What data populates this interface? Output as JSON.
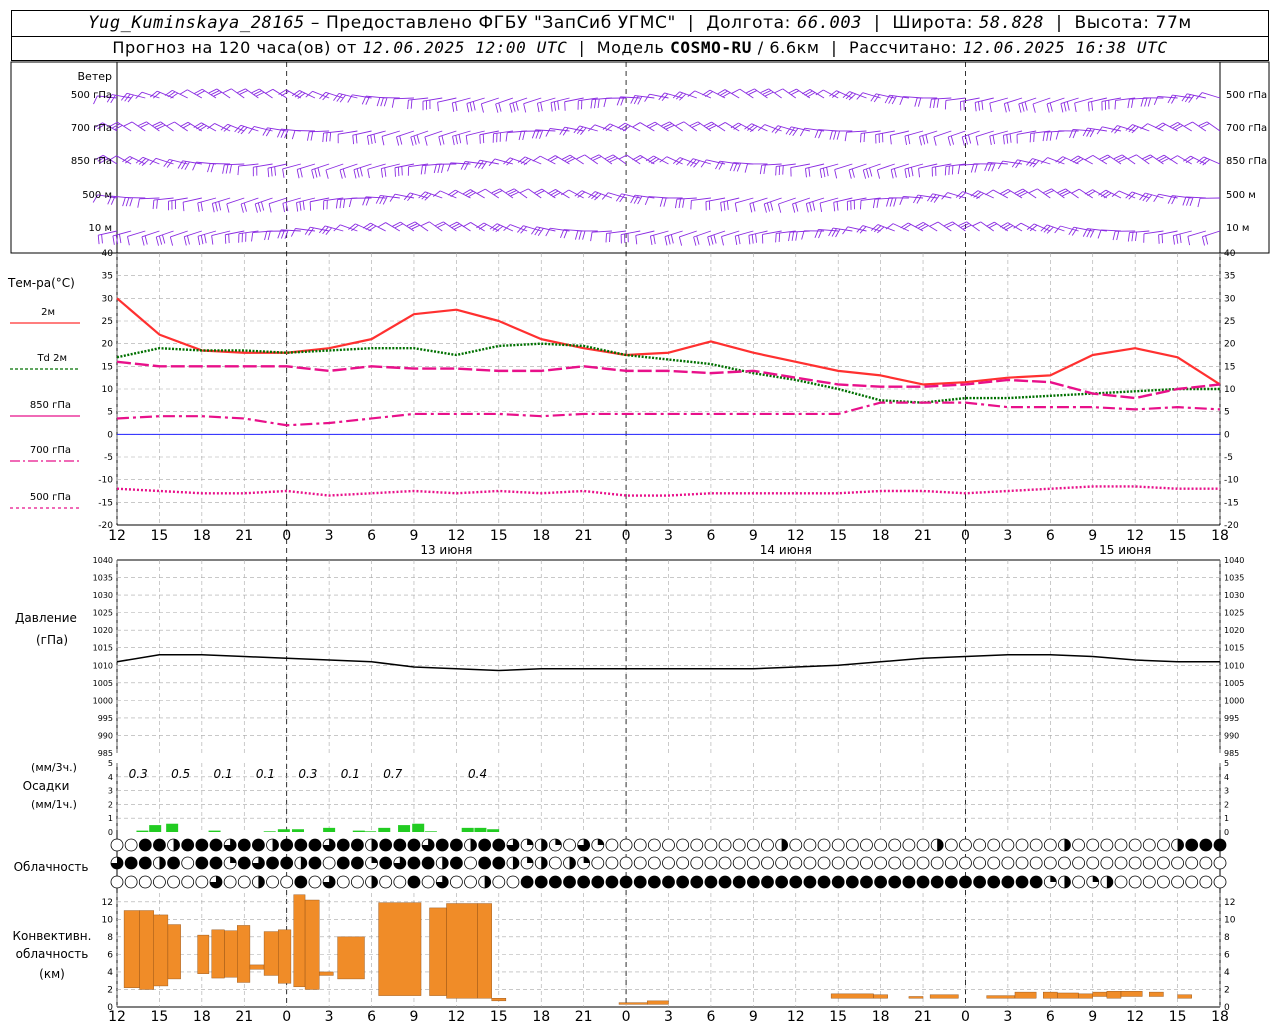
{
  "header": {
    "station": "Yug_Kuminskaya_28165",
    "provider": "– Предоставлено ФГБУ \"ЗапСиб УГМС\"",
    "lon_label": "Долгота:",
    "lon_value": "66.003",
    "lat_label": "Широта:",
    "lat_value": "58.828",
    "alt_label": "Высота:",
    "alt_value": "77м",
    "forecast_prefix": "Прогноз на 120 часа(ов) от",
    "forecast_start": "12.06.2025 12:00 UTC",
    "model_label": "Модель",
    "model_name": "COSMO-RU",
    "model_res": "/ 6.6км",
    "calc_label": "Рассчитано:",
    "calc_time": "12.06.2025 16:38 UTC"
  },
  "wind_panel": {
    "title": "Ветер",
    "levels": [
      "500 гПа",
      "700 гПа",
      "850 гПа",
      "500 м",
      "10 м"
    ]
  },
  "temp_panel": {
    "title": "Тем-ра(°С)",
    "legend": [
      {
        "label": "2м",
        "color": "#ff3030"
      },
      {
        "label": "Td 2м",
        "color": "#007000"
      },
      {
        "label": "850 гПа",
        "color": "#e8108a"
      },
      {
        "label": "700 гПа",
        "color": "#e8108a"
      },
      {
        "label": "500 гПа",
        "color": "#e8108a"
      }
    ]
  },
  "pressure_panel": {
    "title_1": "Давление",
    "title_2": "(гПа)"
  },
  "precip_panel": {
    "title_1": "(мм/3ч.)",
    "title_2": "Осадки",
    "title_3": "(мм/1ч.)"
  },
  "cloud_panel": {
    "title": "Облачность"
  },
  "conv_panel": {
    "title_1": "Конвективн.",
    "title_2": "облачность",
    "title_3": "(км)"
  },
  "time_axis": {
    "tick_labels": [
      "12",
      "15",
      "18",
      "21",
      "0",
      "3",
      "6",
      "9",
      "12",
      "15",
      "18",
      "21",
      "0",
      "3",
      "6",
      "9",
      "12",
      "15",
      "18",
      "21",
      "0",
      "3",
      "6",
      "9",
      "12",
      "15",
      "18"
    ],
    "dates": [
      "13 июня",
      "14 июня",
      "15 июня"
    ]
  },
  "colors": {
    "wind": "#8a2be2",
    "t2m": "#ff3030",
    "td2m": "#007000",
    "upper": "#e8108a",
    "zero_line": "#2020ff",
    "pressure": "#000000",
    "precip": "#22cc22",
    "convective": "#f08c28",
    "grid": "#a8a8a8"
  },
  "chart_data": [
    {
      "type": "line",
      "title": "Тем-ра(°С)",
      "x": [
        0,
        3,
        6,
        9,
        12,
        15,
        18,
        21,
        24,
        27,
        30,
        33,
        36,
        39,
        42,
        45,
        48,
        51,
        54,
        57,
        60,
        63,
        66,
        69,
        72,
        75,
        78
      ],
      "ylim": [
        -20,
        40
      ],
      "yticks": [
        -20,
        -15,
        -10,
        -5,
        0,
        5,
        10,
        15,
        20,
        25,
        30,
        35,
        40
      ],
      "series": [
        {
          "name": "2м",
          "style": "solid",
          "values": [
            30,
            22,
            18.5,
            18,
            18,
            19,
            21,
            26.5,
            27.5,
            25,
            21,
            19,
            17.5,
            18,
            20.5,
            18,
            16,
            14,
            13,
            11,
            11.5,
            12.5,
            13,
            17.5,
            19,
            17,
            11
          ]
        },
        {
          "name": "Td 2м",
          "style": "dotted",
          "values": [
            17,
            19,
            18.5,
            18.5,
            18,
            18.5,
            19,
            19,
            17.5,
            19.5,
            20,
            19.5,
            17.5,
            16.5,
            15.5,
            13.5,
            12,
            10,
            7.5,
            7,
            8,
            8,
            8.5,
            9,
            9.5,
            10,
            10
          ]
        },
        {
          "name": "850 гПа",
          "style": "longdash",
          "values": [
            16,
            15,
            15,
            15,
            15,
            14,
            15,
            14.5,
            14.5,
            14,
            14,
            15,
            14,
            14,
            13.5,
            14,
            12.5,
            11,
            10.5,
            10.5,
            11,
            12,
            11.5,
            9,
            8,
            10,
            11
          ]
        },
        {
          "name": "700 гПа",
          "style": "dashdot",
          "values": [
            3.5,
            4,
            4,
            3.5,
            2,
            2.5,
            3.5,
            4.5,
            4.5,
            4.5,
            4,
            4.5,
            4.5,
            4.5,
            4.5,
            4.5,
            4.5,
            4.5,
            7,
            7,
            7,
            6,
            6,
            6,
            5.5,
            6,
            5.5
          ]
        },
        {
          "name": "500 гПа",
          "style": "dotted",
          "values": [
            -12,
            -12.5,
            -13,
            -13,
            -12.5,
            -13.5,
            -13,
            -12.5,
            -13,
            -12.5,
            -13,
            -12.5,
            -13.5,
            -13.5,
            -13,
            -13,
            -13,
            -13,
            -12.5,
            -12.5,
            -13,
            -12.5,
            -12,
            -11.5,
            -11.5,
            -12,
            -12
          ]
        }
      ]
    },
    {
      "type": "line",
      "title": "Давление (гПа)",
      "x": [
        0,
        3,
        6,
        9,
        12,
        15,
        18,
        21,
        24,
        27,
        30,
        33,
        36,
        39,
        42,
        45,
        48,
        51,
        54,
        57,
        60,
        63,
        66,
        69,
        72,
        75,
        78
      ],
      "ylim": [
        985,
        1040
      ],
      "yticks": [
        985,
        990,
        995,
        1000,
        1005,
        1010,
        1015,
        1020,
        1025,
        1030,
        1035,
        1040
      ],
      "series": [
        {
          "name": "Давление",
          "values": [
            1011,
            1013,
            1013,
            1012.5,
            1012,
            1011.5,
            1011,
            1009.5,
            1009,
            1008.5,
            1009,
            1009,
            1009,
            1009,
            1009,
            1009,
            1009.5,
            1010,
            1011,
            1012,
            1012.5,
            1013,
            1013,
            1012.5,
            1011.5,
            1011,
            1011
          ]
        }
      ]
    },
    {
      "type": "bar",
      "title": "Осадки",
      "ylim": [
        0,
        5
      ],
      "yticks": [
        0,
        1,
        2,
        3,
        4,
        5
      ],
      "x": [
        1.8,
        2.7,
        3.9,
        6.9,
        10.8,
        11.8,
        12.8,
        15.0,
        17.1,
        17.9,
        18.9,
        20.3,
        21.3,
        22.2,
        24.8,
        25.7,
        26.6
      ],
      "values": [
        0.1,
        0.5,
        0.6,
        0.1,
        0.05,
        0.2,
        0.2,
        0.3,
        0.1,
        0.05,
        0.3,
        0.5,
        0.6,
        0.05,
        0.3,
        0.3,
        0.2
      ],
      "annotations": [
        {
          "x": 1.5,
          "text": "0.3"
        },
        {
          "x": 4.5,
          "text": "0.5"
        },
        {
          "x": 7.5,
          "text": "0.1"
        },
        {
          "x": 10.5,
          "text": "0.1"
        },
        {
          "x": 13.5,
          "text": "0.3"
        },
        {
          "x": 16.5,
          "text": "0.1"
        },
        {
          "x": 19.5,
          "text": "0.7"
        },
        {
          "x": 25.5,
          "text": "0.4"
        }
      ]
    },
    {
      "type": "bar",
      "title": "Конвективн. облачность (км)",
      "ylim": [
        0,
        13
      ],
      "yticks": [
        0,
        2,
        4,
        6,
        8,
        10,
        12
      ],
      "bars": [
        {
          "x0": 0.5,
          "x1": 1.6,
          "b": 2.2,
          "t": 11
        },
        {
          "x0": 1.6,
          "x1": 2.6,
          "b": 2,
          "t": 11
        },
        {
          "x0": 2.6,
          "x1": 3.6,
          "b": 2.4,
          "t": 10.5
        },
        {
          "x0": 3.6,
          "x1": 4.5,
          "b": 3.2,
          "t": 9.4
        },
        {
          "x0": 5.7,
          "x1": 6.5,
          "b": 3.8,
          "t": 8.2
        },
        {
          "x0": 6.7,
          "x1": 7.6,
          "b": 3.3,
          "t": 8.8
        },
        {
          "x0": 7.6,
          "x1": 8.5,
          "b": 3.4,
          "t": 8.7
        },
        {
          "x0": 8.5,
          "x1": 9.4,
          "b": 2.8,
          "t": 9.3
        },
        {
          "x0": 9.4,
          "x1": 10.4,
          "b": 4.3,
          "t": 4.8
        },
        {
          "x0": 10.4,
          "x1": 11.4,
          "b": 3.6,
          "t": 8.6
        },
        {
          "x0": 11.4,
          "x1": 12.3,
          "b": 2.7,
          "t": 8.8
        },
        {
          "x0": 12.5,
          "x1": 13.3,
          "b": 2.3,
          "t": 12.8
        },
        {
          "x0": 13.3,
          "x1": 14.3,
          "b": 2,
          "t": 12.2
        },
        {
          "x0": 14.3,
          "x1": 15.3,
          "b": 3.6,
          "t": 4
        },
        {
          "x0": 15.6,
          "x1": 17.5,
          "b": 3.2,
          "t": 8
        },
        {
          "x0": 18.5,
          "x1": 21.5,
          "b": 1.3,
          "t": 11.9
        },
        {
          "x0": 22.1,
          "x1": 23.3,
          "b": 1.3,
          "t": 11.3
        },
        {
          "x0": 23.3,
          "x1": 25.5,
          "b": 1,
          "t": 11.8
        },
        {
          "x0": 25.5,
          "x1": 26.5,
          "b": 1,
          "t": 11.8
        },
        {
          "x0": 26.5,
          "x1": 27.5,
          "b": 0.7,
          "t": 1
        },
        {
          "x0": 35.5,
          "x1": 37.5,
          "b": 0.3,
          "t": 0.5
        },
        {
          "x0": 37.5,
          "x1": 39,
          "b": 0.3,
          "t": 0.7
        },
        {
          "x0": 50.5,
          "x1": 53.5,
          "b": 1,
          "t": 1.5
        },
        {
          "x0": 53.5,
          "x1": 54.5,
          "b": 1,
          "t": 1.4
        },
        {
          "x0": 56,
          "x1": 57,
          "b": 1,
          "t": 1.2
        },
        {
          "x0": 57.5,
          "x1": 59.5,
          "b": 1,
          "t": 1.4
        },
        {
          "x0": 61.5,
          "x1": 63.5,
          "b": 1,
          "t": 1.3
        },
        {
          "x0": 63.5,
          "x1": 65,
          "b": 1,
          "t": 1.7
        },
        {
          "x0": 65.5,
          "x1": 66.5,
          "b": 1,
          "t": 1.7
        },
        {
          "x0": 66.5,
          "x1": 68,
          "b": 1,
          "t": 1.6
        },
        {
          "x0": 68,
          "x1": 69,
          "b": 1,
          "t": 1.5
        },
        {
          "x0": 69,
          "x1": 70,
          "b": 1.2,
          "t": 1.7
        },
        {
          "x0": 70,
          "x1": 71,
          "b": 1,
          "t": 1.8
        },
        {
          "x0": 71,
          "x1": 72.5,
          "b": 1.2,
          "t": 1.8
        },
        {
          "x0": 73,
          "x1": 74,
          "b": 1.2,
          "t": 1.7
        },
        {
          "x0": 75,
          "x1": 76,
          "b": 1,
          "t": 1.4
        }
      ]
    }
  ]
}
